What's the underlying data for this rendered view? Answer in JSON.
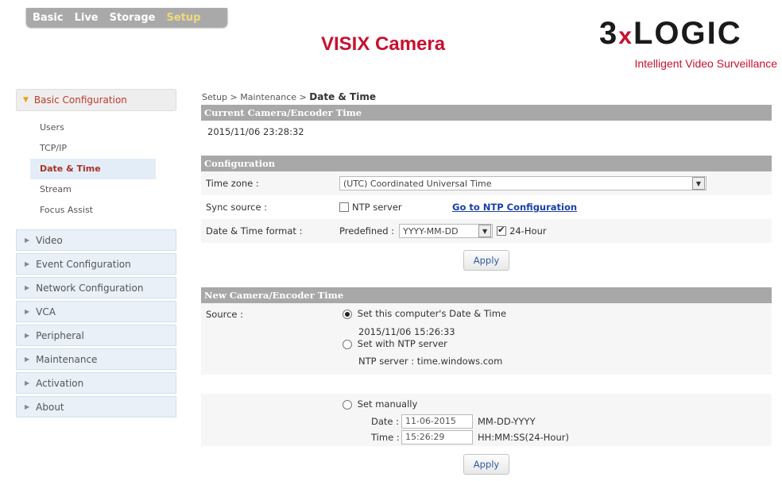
{
  "topnav": {
    "items": [
      {
        "label": "Basic",
        "active": false
      },
      {
        "label": "Live",
        "active": false
      },
      {
        "label": "Storage",
        "active": false
      },
      {
        "label": "Setup",
        "active": true
      }
    ]
  },
  "header": {
    "title": "VISIX Camera",
    "logo_text_a": "3",
    "logo_text_x": "x",
    "logo_text_b": "LOGIC",
    "tagline": "Intelligent Video Surveillance"
  },
  "sidebar": {
    "head_label": "Basic Configuration",
    "subitems": [
      "Users",
      "TCP/IP",
      "Date & Time",
      "Stream",
      "Focus Assist"
    ],
    "groups": [
      "Video",
      "Event Configuration",
      "Network Configuration",
      "VCA",
      "Peripheral",
      "Maintenance",
      "Activation",
      "About"
    ]
  },
  "breadcrumb": {
    "path": "Setup > Maintenance > ",
    "current": "Date & Time"
  },
  "current_time": {
    "header": "Current Camera/Encoder Time",
    "value": "2015/11/06 23:28:32"
  },
  "config": {
    "header": "Configuration",
    "timezone_label": "Time zone :",
    "timezone_value": "(UTC) Coordinated Universal Time",
    "sync_label": "Sync source :",
    "ntp_checkbox_label": "NTP server",
    "ntp_link": "Go to NTP Configuration",
    "format_label": "Date & Time format :",
    "predefined_label": "Predefined :",
    "format_value": "YYYY-MM-DD",
    "hour24_label": "24-Hour",
    "apply": "Apply"
  },
  "new_time": {
    "header": "New Camera/Encoder Time",
    "source_label": "Source :",
    "opt_computer": "Set this computer's Date & Time",
    "computer_value": "2015/11/06 15:26:33",
    "opt_ntp": "Set with NTP server",
    "ntp_value": "NTP server : time.windows.com",
    "opt_manual": "Set manually",
    "date_label": "Date :",
    "date_value": "11-06-2015",
    "date_hint": "MM-DD-YYYY",
    "time_label": "Time :",
    "time_value": "15:26:29",
    "time_hint": "HH:MM:SS(24-Hour)",
    "apply": "Apply"
  },
  "colors": {
    "accent_red": "#c8102e",
    "section_gray": "#a8a8a8",
    "link_blue": "#1a3fa8"
  }
}
